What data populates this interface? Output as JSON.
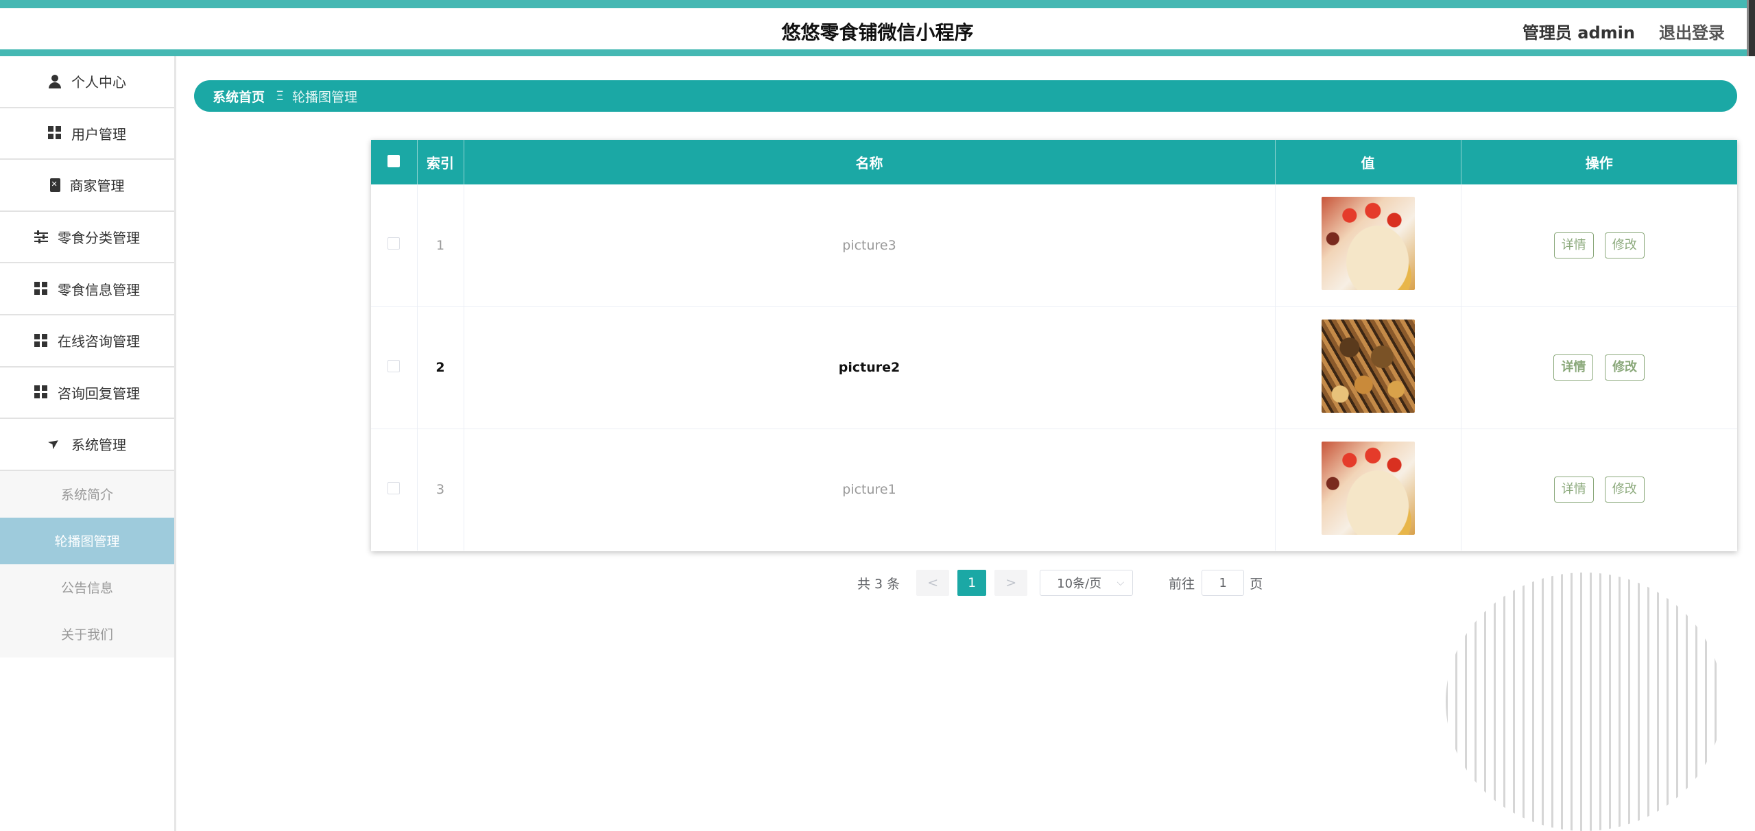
{
  "header": {
    "title": "悠悠零食铺微信小程序",
    "user_label": "管理员 admin",
    "logout_label": "退出登录"
  },
  "sidebar": {
    "items": [
      {
        "label": "个人中心",
        "icon": "user-icon"
      },
      {
        "label": "用户管理",
        "icon": "grid-icon"
      },
      {
        "label": "商家管理",
        "icon": "clipboard-icon"
      },
      {
        "label": "零食分类管理",
        "icon": "sliders-icon"
      },
      {
        "label": "零食信息管理",
        "icon": "grid-icon"
      },
      {
        "label": "在线咨询管理",
        "icon": "grid-icon"
      },
      {
        "label": "咨询回复管理",
        "icon": "grid-icon"
      },
      {
        "label": "系统管理",
        "icon": "paper-plane-icon"
      }
    ],
    "sub_items": [
      {
        "label": "系统简介"
      },
      {
        "label": "轮播图管理",
        "active": true
      },
      {
        "label": "公告信息"
      },
      {
        "label": "关于我们"
      }
    ]
  },
  "breadcrumb": {
    "home": "系统首页",
    "separator": "Ξ",
    "current": "轮播图管理"
  },
  "table": {
    "columns": [
      "索引",
      "名称",
      "值",
      "操作"
    ],
    "rows": [
      {
        "index": "1",
        "name": "picture3",
        "image": "cake-thumbnail"
      },
      {
        "index": "2",
        "name": "picture2",
        "image": "nuts-thumbnail"
      },
      {
        "index": "3",
        "name": "picture1",
        "image": "cake-thumbnail"
      }
    ],
    "detail_label": "详情",
    "edit_label": "修改"
  },
  "pagination": {
    "total": "共 3 条",
    "prev": "<",
    "current_page": "1",
    "next": ">",
    "page_size": "10条/页",
    "goto_label": "前往",
    "goto_value": "1",
    "page_unit": "页"
  },
  "colors": {
    "accent": "#1ba8a5",
    "header_border": "#45b8b3",
    "active_sub_item": "#9ecbdc",
    "button_border": "#8aa87a"
  }
}
